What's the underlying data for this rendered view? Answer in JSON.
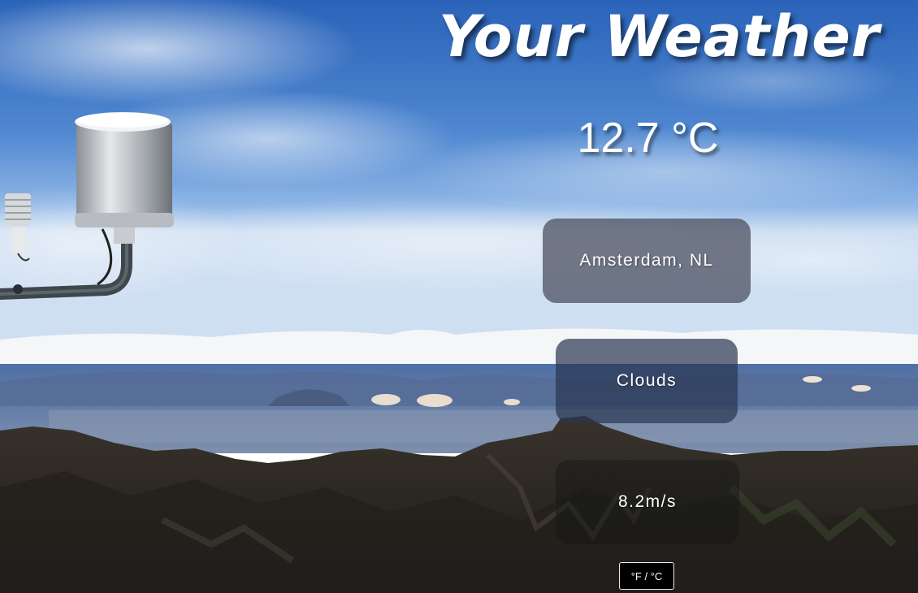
{
  "header": {
    "title": "Your Weather"
  },
  "weather": {
    "temperature": "12.7 °C",
    "location": "Amsterdam, NL",
    "condition": "Clouds",
    "wind": "8.2m/s"
  },
  "controls": {
    "unit_toggle_label": "°F / °C"
  },
  "colors": {
    "sky_top": "#1f5fb8",
    "sky_mid": "#6fa0dc",
    "cloud_band": "#f2f4f7",
    "mountain": "#2f2a25"
  },
  "icons": {
    "weather_station": "weather-station-icon"
  }
}
